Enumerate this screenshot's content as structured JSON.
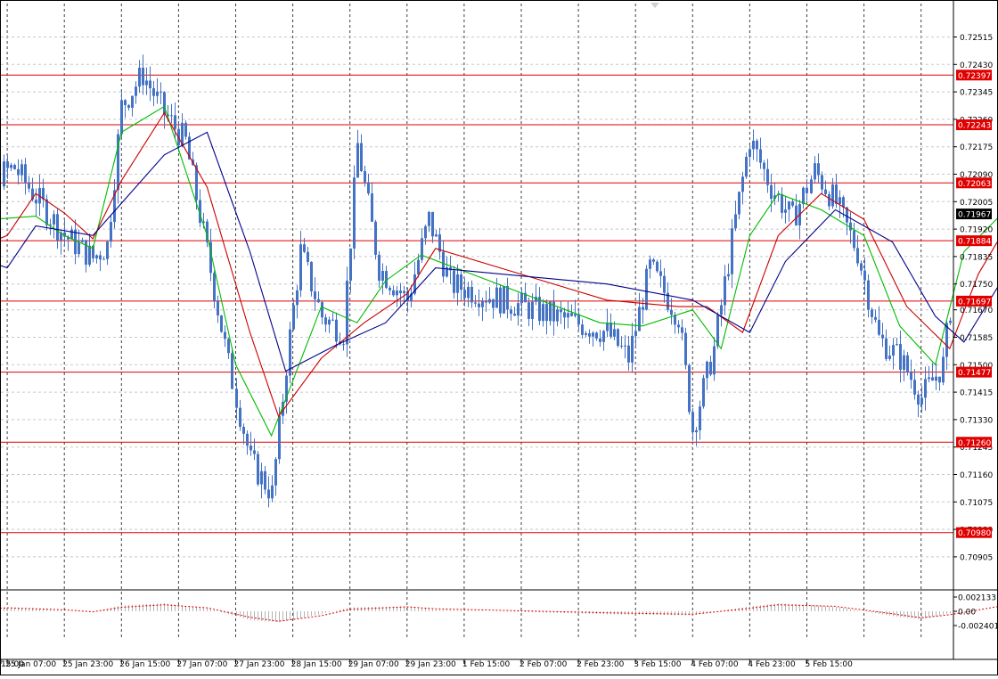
{
  "colors": {
    "background": "#ffffff",
    "frame": "#000000",
    "grid": "#000000",
    "candles": "#4472c4",
    "level_line": "#e00000",
    "level_label_bg": "#e00000",
    "level_label_text": "#ffffff",
    "current_label_bg": "#000000",
    "current_label_text": "#ffffff",
    "ma_fast": "#00bb00",
    "ma_mid": "#cc0000",
    "ma_slow": "#00008b",
    "osc_hist": "#b4b4b4",
    "osc_signal": "#e00000"
  },
  "chart_data": {
    "type": "candlestick",
    "symbol_hint": "",
    "x_tick_labels": [
      "15:00",
      "25 Jan 07:00",
      "25 Jan 23:00",
      "26 Jan 15:00",
      "27 Jan 07:00",
      "27 Jan 23:00",
      "28 Jan 15:00",
      "29 Jan 07:00",
      "29 Jan 23:00",
      "1 Feb 15:00",
      "2 Feb 07:00",
      "2 Feb 23:00",
      "3 Feb 15:00",
      "4 Feb 07:00",
      "4 Feb 23:00",
      "5 Feb 15:00"
    ],
    "y_tick_labels": [
      "0.72515",
      "0.72430",
      "0.72345",
      "0.72260",
      "0.72175",
      "0.72090",
      "0.72005",
      "0.71920",
      "0.71835",
      "0.71750",
      "0.71670",
      "0.71585",
      "0.71500",
      "0.71415",
      "0.71330",
      "0.71245",
      "0.71160",
      "0.71075",
      "0.70990",
      "0.70905"
    ],
    "ylim": [
      0.7089,
      0.7253
    ],
    "grid": true,
    "levels": [
      "0.72397",
      "0.72243",
      "0.72063",
      "0.71884",
      "0.71697",
      "0.71477",
      "0.71260",
      "0.70980"
    ],
    "current_price": "0.71967",
    "price_path": [
      {
        "date": "24 Jan 15:00",
        "price": 0.7183
      },
      {
        "date": "24 Jan 23:00",
        "price": 0.7194
      },
      {
        "date": "25 Jan 03:00",
        "price": 0.7208
      },
      {
        "date": "25 Jan 09:00",
        "price": 0.7211
      },
      {
        "date": "25 Jan 15:00",
        "price": 0.7202
      },
      {
        "date": "25 Jan 23:00",
        "price": 0.719
      },
      {
        "date": "26 Jan 07:00",
        "price": 0.7183
      },
      {
        "date": "26 Jan 11:00",
        "price": 0.7187
      },
      {
        "date": "26 Jan 15:00",
        "price": 0.723
      },
      {
        "date": "26 Jan 21:00",
        "price": 0.724
      },
      {
        "date": "27 Jan 03:00",
        "price": 0.7228
      },
      {
        "date": "27 Jan 09:00",
        "price": 0.7219
      },
      {
        "date": "27 Jan 15:00",
        "price": 0.7185
      },
      {
        "date": "27 Jan 21:00",
        "price": 0.715
      },
      {
        "date": "28 Jan 03:00",
        "price": 0.712
      },
      {
        "date": "28 Jan 09:00",
        "price": 0.711
      },
      {
        "date": "28 Jan 13:00",
        "price": 0.715
      },
      {
        "date": "28 Jan 17:00",
        "price": 0.7185
      },
      {
        "date": "28 Jan 23:00",
        "price": 0.7165
      },
      {
        "date": "29 Jan 05:00",
        "price": 0.716
      },
      {
        "date": "29 Jan 09:00",
        "price": 0.7218
      },
      {
        "date": "29 Jan 15:00",
        "price": 0.718
      },
      {
        "date": "29 Jan 23:00",
        "price": 0.717
      },
      {
        "date": "30 Jan 05:00",
        "price": 0.7195
      },
      {
        "date": "30 Jan 11:00",
        "price": 0.7175
      },
      {
        "date": "1 Feb 07:00",
        "price": 0.716
      },
      {
        "date": "1 Feb 13:00",
        "price": 0.7152
      },
      {
        "date": "1 Feb 19:00",
        "price": 0.718
      },
      {
        "date": "2 Feb 03:00",
        "price": 0.7165
      },
      {
        "date": "2 Feb 07:00",
        "price": 0.713
      },
      {
        "date": "2 Feb 13:00",
        "price": 0.7155
      },
      {
        "date": "2 Feb 19:00",
        "price": 0.7195
      },
      {
        "date": "2 Feb 23:00",
        "price": 0.722
      },
      {
        "date": "3 Feb 05:00",
        "price": 0.7205
      },
      {
        "date": "3 Feb 11:00",
        "price": 0.7195
      },
      {
        "date": "3 Feb 17:00",
        "price": 0.721
      },
      {
        "date": "3 Feb 23:00",
        "price": 0.72
      },
      {
        "date": "4 Feb 05:00",
        "price": 0.7185
      },
      {
        "date": "4 Feb 11:00",
        "price": 0.7158
      },
      {
        "date": "4 Feb 17:00",
        "price": 0.7152
      },
      {
        "date": "4 Feb 23:00",
        "price": 0.714
      },
      {
        "date": "5 Feb 05:00",
        "price": 0.715
      },
      {
        "date": "5 Feb 09:00",
        "price": 0.7185
      },
      {
        "date": "5 Feb 13:00",
        "price": 0.72
      },
      {
        "date": "5 Feb 17:00",
        "price": 0.7203
      },
      {
        "date": "5 Feb 21:00",
        "price": 0.7197
      }
    ],
    "moving_averages": [
      {
        "color_key": "ma_fast",
        "points": [
          {
            "date": "24 Jan 15:00",
            "price": 0.7178
          },
          {
            "date": "25 Jan 03:00",
            "price": 0.7195
          },
          {
            "date": "25 Jan 15:00",
            "price": 0.7196
          },
          {
            "date": "25 Jan 23:00",
            "price": 0.719
          },
          {
            "date": "26 Jan 07:00",
            "price": 0.7186
          },
          {
            "date": "26 Jan 15:00",
            "price": 0.7222
          },
          {
            "date": "27 Jan 03:00",
            "price": 0.723
          },
          {
            "date": "27 Jan 15:00",
            "price": 0.719
          },
          {
            "date": "27 Jan 23:00",
            "price": 0.715
          },
          {
            "date": "28 Jan 09:00",
            "price": 0.7128
          },
          {
            "date": "28 Jan 15:00",
            "price": 0.7145
          },
          {
            "date": "28 Jan 23:00",
            "price": 0.7168
          },
          {
            "date": "29 Jan 09:00",
            "price": 0.7163
          },
          {
            "date": "29 Jan 17:00",
            "price": 0.7176
          },
          {
            "date": "30 Jan 03:00",
            "price": 0.7184
          },
          {
            "date": "1 Feb 05:00",
            "price": 0.7163
          },
          {
            "date": "1 Feb 17:00",
            "price": 0.7162
          },
          {
            "date": "2 Feb 07:00",
            "price": 0.7167
          },
          {
            "date": "2 Feb 15:00",
            "price": 0.7155
          },
          {
            "date": "2 Feb 23:00",
            "price": 0.719
          },
          {
            "date": "3 Feb 07:00",
            "price": 0.7203
          },
          {
            "date": "3 Feb 19:00",
            "price": 0.7198
          },
          {
            "date": "4 Feb 07:00",
            "price": 0.719
          },
          {
            "date": "4 Feb 17:00",
            "price": 0.7162
          },
          {
            "date": "5 Feb 03:00",
            "price": 0.715
          },
          {
            "date": "5 Feb 11:00",
            "price": 0.7185
          },
          {
            "date": "5 Feb 21:00",
            "price": 0.7196
          }
        ]
      },
      {
        "color_key": "ma_mid",
        "points": [
          {
            "date": "24 Jan 15:00",
            "price": 0.7183
          },
          {
            "date": "25 Jan 07:00",
            "price": 0.719
          },
          {
            "date": "25 Jan 15:00",
            "price": 0.7203
          },
          {
            "date": "25 Jan 23:00",
            "price": 0.7197
          },
          {
            "date": "26 Jan 07:00",
            "price": 0.7189
          },
          {
            "date": "26 Jan 15:00",
            "price": 0.7207
          },
          {
            "date": "27 Jan 03:00",
            "price": 0.7228
          },
          {
            "date": "27 Jan 15:00",
            "price": 0.7205
          },
          {
            "date": "28 Jan 03:00",
            "price": 0.716
          },
          {
            "date": "28 Jan 11:00",
            "price": 0.7134
          },
          {
            "date": "28 Jan 23:00",
            "price": 0.7152
          },
          {
            "date": "29 Jan 11:00",
            "price": 0.7163
          },
          {
            "date": "29 Jan 23:00",
            "price": 0.7172
          },
          {
            "date": "30 Jan 07:00",
            "price": 0.7186
          },
          {
            "date": "1 Feb 07:00",
            "price": 0.717
          },
          {
            "date": "2 Feb 03:00",
            "price": 0.7168
          },
          {
            "date": "2 Feb 11:00",
            "price": 0.7168
          },
          {
            "date": "2 Feb 21:00",
            "price": 0.716
          },
          {
            "date": "3 Feb 07:00",
            "price": 0.719
          },
          {
            "date": "3 Feb 19:00",
            "price": 0.7203
          },
          {
            "date": "4 Feb 07:00",
            "price": 0.7195
          },
          {
            "date": "4 Feb 19:00",
            "price": 0.7168
          },
          {
            "date": "5 Feb 07:00",
            "price": 0.7155
          },
          {
            "date": "5 Feb 15:00",
            "price": 0.7178
          },
          {
            "date": "5 Feb 23:00",
            "price": 0.7193
          }
        ]
      },
      {
        "color_key": "ma_slow",
        "points": [
          {
            "date": "24 Jan 15:00",
            "price": 0.7186
          },
          {
            "date": "25 Jan 07:00",
            "price": 0.718
          },
          {
            "date": "25 Jan 15:00",
            "price": 0.7193
          },
          {
            "date": "26 Jan 07:00",
            "price": 0.719
          },
          {
            "date": "26 Jan 15:00",
            "price": 0.72
          },
          {
            "date": "27 Jan 03:00",
            "price": 0.7215
          },
          {
            "date": "27 Jan 15:00",
            "price": 0.7222
          },
          {
            "date": "28 Jan 03:00",
            "price": 0.7185
          },
          {
            "date": "28 Jan 13:00",
            "price": 0.7148
          },
          {
            "date": "29 Jan 03:00",
            "price": 0.7156
          },
          {
            "date": "29 Jan 17:00",
            "price": 0.7163
          },
          {
            "date": "30 Jan 07:00",
            "price": 0.718
          },
          {
            "date": "1 Feb 07:00",
            "price": 0.7175
          },
          {
            "date": "2 Feb 07:00",
            "price": 0.717
          },
          {
            "date": "2 Feb 23:00",
            "price": 0.716
          },
          {
            "date": "3 Feb 09:00",
            "price": 0.7182
          },
          {
            "date": "3 Feb 23:00",
            "price": 0.7198
          },
          {
            "date": "4 Feb 15:00",
            "price": 0.7188
          },
          {
            "date": "5 Feb 03:00",
            "price": 0.7165
          },
          {
            "date": "5 Feb 11:00",
            "price": 0.7157
          },
          {
            "date": "5 Feb 21:00",
            "price": 0.7175
          },
          {
            "date": "6 Feb 03:00",
            "price": 0.7186
          }
        ]
      }
    ],
    "oscillator": {
      "y_tick_labels": [
        "0.002133",
        "0.00",
        "-0.002401"
      ],
      "ylim": [
        -0.0025,
        0.0025
      ],
      "histogram": [
        {
          "date": "24 Jan 15:00",
          "value": 0.0002
        },
        {
          "date": "25 Jan 07:00",
          "value": 0.0008
        },
        {
          "date": "25 Jan 23:00",
          "value": 0.0001
        },
        {
          "date": "26 Jan 07:00",
          "value": -0.0002
        },
        {
          "date": "26 Jan 15:00",
          "value": 0.0012
        },
        {
          "date": "27 Jan 03:00",
          "value": 0.0016
        },
        {
          "date": "27 Jan 15:00",
          "value": 0.0006
        },
        {
          "date": "28 Jan 03:00",
          "value": -0.0018
        },
        {
          "date": "28 Jan 11:00",
          "value": -0.0022
        },
        {
          "date": "28 Jan 23:00",
          "value": -0.0005
        },
        {
          "date": "29 Jan 07:00",
          "value": 0.0008
        },
        {
          "date": "29 Jan 23:00",
          "value": 0.001
        },
        {
          "date": "30 Jan 07:00",
          "value": 0.0003
        },
        {
          "date": "1 Feb 07:00",
          "value": -0.0006
        },
        {
          "date": "2 Feb 07:00",
          "value": -0.0008
        },
        {
          "date": "2 Feb 23:00",
          "value": 0.001
        },
        {
          "date": "3 Feb 07:00",
          "value": 0.0016
        },
        {
          "date": "3 Feb 23:00",
          "value": 0.0009
        },
        {
          "date": "4 Feb 15:00",
          "value": -0.001
        },
        {
          "date": "4 Feb 23:00",
          "value": -0.0016
        },
        {
          "date": "5 Feb 07:00",
          "value": -0.0004
        },
        {
          "date": "5 Feb 21:00",
          "value": 0.0012
        }
      ],
      "signal": [
        {
          "date": "24 Jan 15:00",
          "value": 0.0001
        },
        {
          "date": "25 Jan 07:00",
          "value": 0.0007
        },
        {
          "date": "25 Jan 23:00",
          "value": 0.0003
        },
        {
          "date": "26 Jan 07:00",
          "value": -0.0001
        },
        {
          "date": "26 Jan 15:00",
          "value": 0.0008
        },
        {
          "date": "27 Jan 03:00",
          "value": 0.0013
        },
        {
          "date": "27 Jan 15:00",
          "value": 0.0007
        },
        {
          "date": "28 Jan 03:00",
          "value": -0.0012
        },
        {
          "date": "28 Jan 11:00",
          "value": -0.002
        },
        {
          "date": "28 Jan 23:00",
          "value": -0.0009
        },
        {
          "date": "29 Jan 07:00",
          "value": 0.0004
        },
        {
          "date": "29 Jan 23:00",
          "value": 0.0009
        },
        {
          "date": "30 Jan 07:00",
          "value": 0.0005
        },
        {
          "date": "1 Feb 07:00",
          "value": -0.0003
        },
        {
          "date": "2 Feb 07:00",
          "value": -0.0006
        },
        {
          "date": "2 Feb 23:00",
          "value": 0.0006
        },
        {
          "date": "3 Feb 07:00",
          "value": 0.0013
        },
        {
          "date": "3 Feb 23:00",
          "value": 0.001
        },
        {
          "date": "4 Feb 15:00",
          "value": -0.0005
        },
        {
          "date": "4 Feb 23:00",
          "value": -0.0013
        },
        {
          "date": "5 Feb 07:00",
          "value": -0.0007
        },
        {
          "date": "5 Feb 21:00",
          "value": 0.001
        }
      ]
    }
  }
}
